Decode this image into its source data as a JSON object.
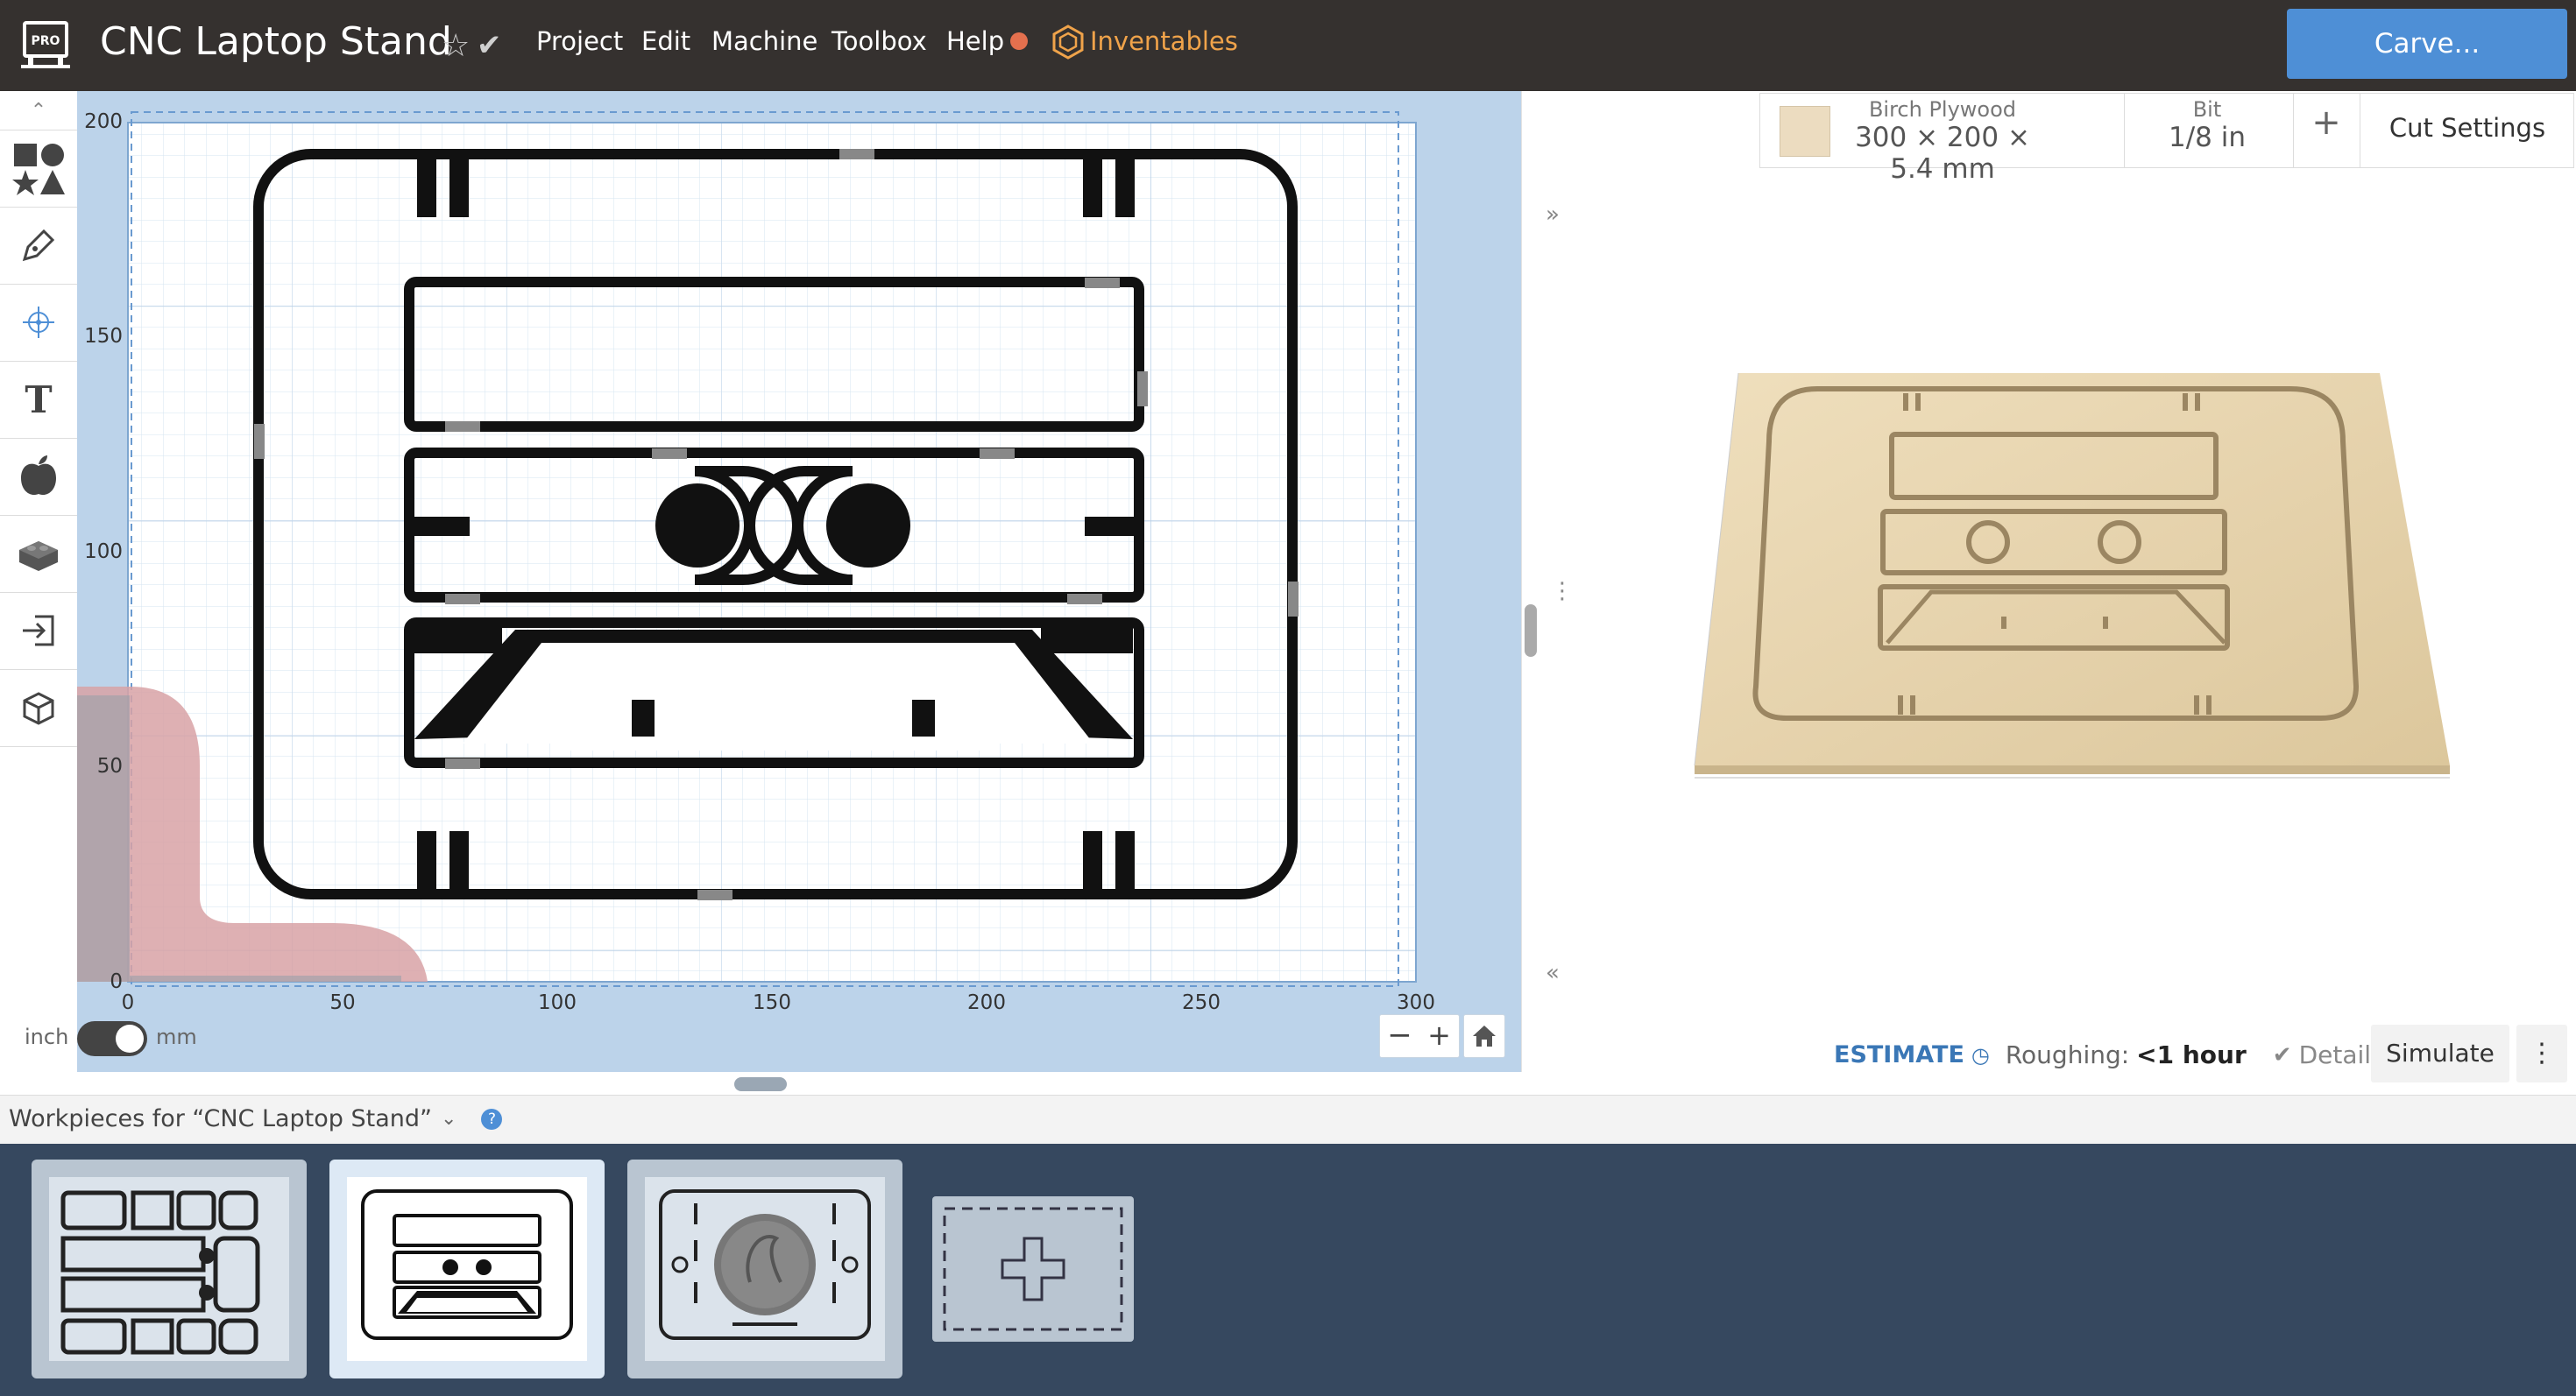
{
  "app": {
    "badge": "PRO",
    "title": "CNC Laptop Stand"
  },
  "menu": [
    {
      "label": "Project"
    },
    {
      "label": "Edit"
    },
    {
      "label": "Machine"
    },
    {
      "label": "Toolbox"
    },
    {
      "label": "Help"
    }
  ],
  "brand": {
    "label": "Inventables",
    "color": "#f0a34a"
  },
  "carve_button": {
    "label": "Carve...",
    "color": "#4e8fd6"
  },
  "tools": [
    {
      "icon": "shapes-icon"
    },
    {
      "icon": "pen-icon"
    },
    {
      "icon": "target-icon"
    },
    {
      "icon": "text-icon",
      "glyph": "T"
    },
    {
      "icon": "apple-icon"
    },
    {
      "icon": "lego-icon"
    },
    {
      "icon": "import-icon"
    },
    {
      "icon": "cube-icon"
    }
  ],
  "canvas": {
    "y_ticks": [
      "200",
      "150",
      "100",
      "50",
      "0"
    ],
    "x_ticks": [
      "0",
      "50",
      "100",
      "150",
      "200",
      "250",
      "300"
    ]
  },
  "units": {
    "left": "inch",
    "right": "mm"
  },
  "material": {
    "name": "Birch Plywood",
    "dimensions": "300 × 200 × 5.4 mm",
    "bit_label": "Bit",
    "bit_value": "1/8 in",
    "add_label": "+",
    "settings_label": "Cut Settings",
    "swatch_color": "#ecdcc0"
  },
  "estimate": {
    "label": "ESTIMATE",
    "roughing_label": "Roughing:",
    "roughing_value": "<1 hour",
    "detailed_label": "Detailed",
    "simulate_label": "Simulate"
  },
  "workpieces": {
    "heading": "Workpieces for “CNC Laptop Stand”",
    "count": 3
  }
}
